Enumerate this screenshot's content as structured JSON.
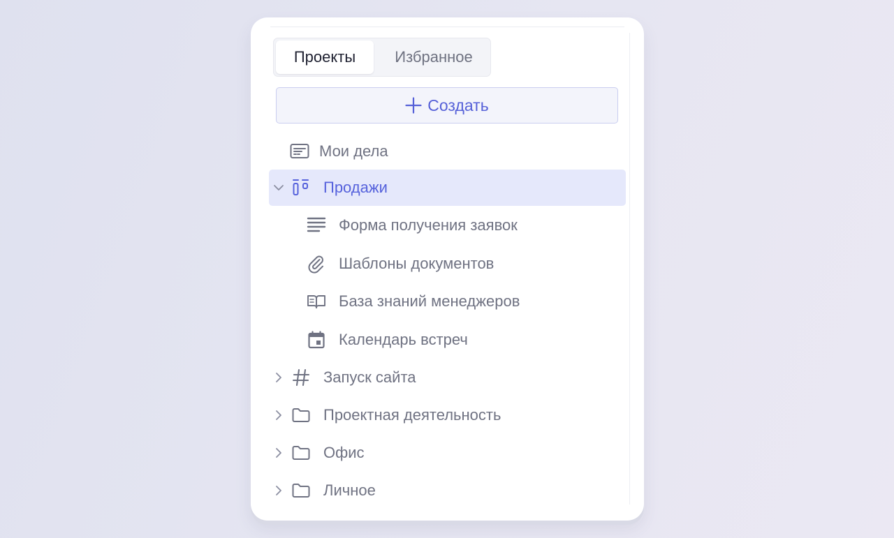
{
  "tabs": [
    {
      "label": "Проекты",
      "active": true
    },
    {
      "label": "Избранное",
      "active": false
    }
  ],
  "create_button": {
    "label": "Создать",
    "icon": "plus-icon"
  },
  "items": [
    {
      "label": "Мои дела",
      "icon": "inbox-card-icon",
      "level": 0
    },
    {
      "label": "Продажи",
      "icon": "board-icon",
      "level": 0,
      "expanded": true,
      "selected": true
    },
    {
      "label": "Форма получения заявок",
      "icon": "form-lines-icon",
      "level": 1
    },
    {
      "label": "Шаблоны документов",
      "icon": "paperclip-icon",
      "level": 1
    },
    {
      "label": "База знаний менеджеров",
      "icon": "book-icon",
      "level": 1
    },
    {
      "label": "Календарь встреч",
      "icon": "calendar-icon",
      "level": 1
    },
    {
      "label": "Запуск сайта",
      "icon": "hash-icon",
      "level": 0,
      "expanded": false
    },
    {
      "label": "Проектная деятельность",
      "icon": "folder-icon",
      "level": 0,
      "expanded": false
    },
    {
      "label": "Офис",
      "icon": "folder-icon",
      "level": 0,
      "expanded": false
    },
    {
      "label": "Личное",
      "icon": "folder-icon",
      "level": 0,
      "expanded": false
    }
  ],
  "colors": {
    "accent": "#5662dc",
    "selected_bg": "#e5e8fb",
    "text_muted": "#6f7282",
    "text_dark": "#1e2030"
  }
}
